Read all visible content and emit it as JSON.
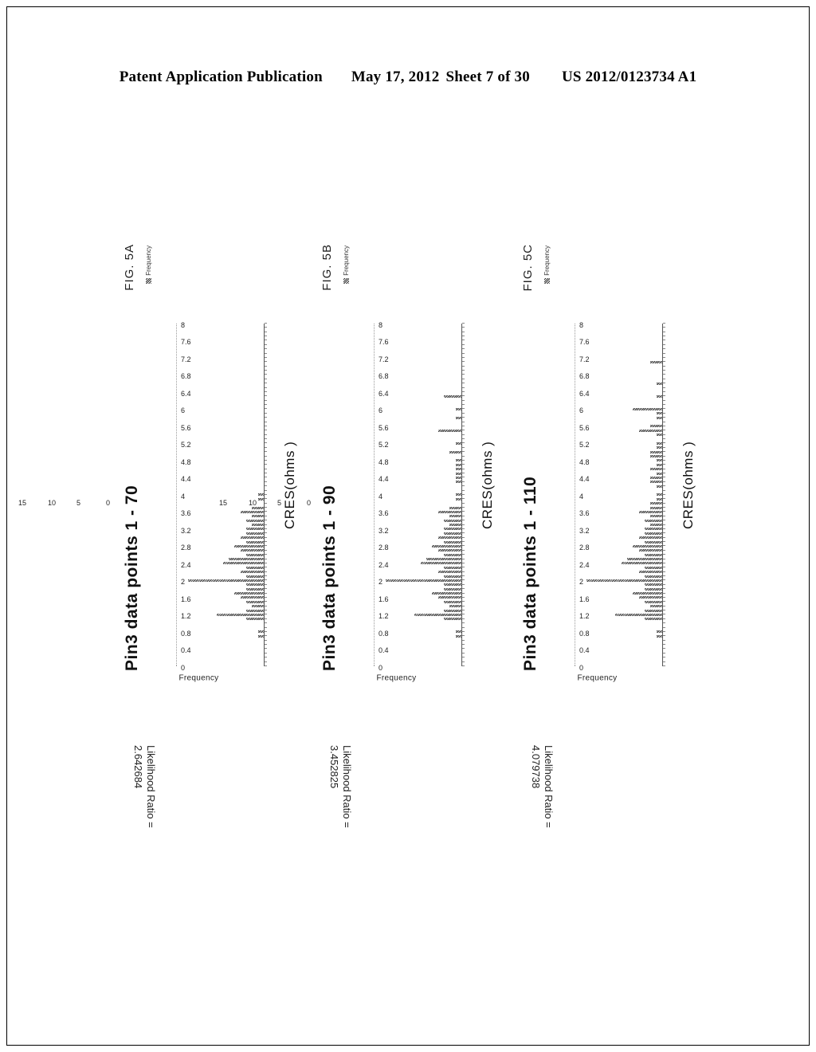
{
  "header": {
    "publication": "Patent Application Publication",
    "date": "May 17, 2012",
    "sheet": "Sheet 7 of 30",
    "docnum": "US 2012/0123734 A1"
  },
  "common": {
    "legend_label": "Frequency",
    "legend_swatch": "hatched-square-icon",
    "xaxis_title": "CRES(ohms )",
    "yaxis_title": "Frequency",
    "y_ticks": [
      "0",
      "5",
      "10",
      "15"
    ],
    "x_ticks": [
      "0",
      "0.4",
      "0.8",
      "1.2",
      "1.6",
      "2",
      "2.4",
      "2.8",
      "3.2",
      "3.6",
      "4",
      "4.4",
      "4.8",
      "5.2",
      "5.6",
      "6",
      "6.4",
      "6.8",
      "7.2",
      "7.6",
      "8"
    ],
    "likelihood_label": "Likelihood Ratio ="
  },
  "figures": [
    {
      "id": "fig-5a",
      "title": "Pin3 data points 1 - 70",
      "label": "FIG. 5A",
      "likelihood_value": "2.642684",
      "chart_data": {
        "type": "bar",
        "title": "Pin3 data points 1 - 70",
        "xlabel": "CRES(ohms )",
        "ylabel": "Frequency",
        "ylim": [
          0,
          15
        ],
        "xlim": [
          0,
          8
        ],
        "grid": true,
        "legend": [
          "Frequency"
        ],
        "legend_position": "top-right",
        "bin_width": 0.1,
        "x": [
          0.7,
          0.8,
          1.1,
          1.2,
          1.3,
          1.4,
          1.5,
          1.6,
          1.7,
          1.8,
          1.9,
          2.0,
          2.1,
          2.2,
          2.3,
          2.4,
          2.5,
          2.6,
          2.7,
          2.8,
          2.9,
          3.0,
          3.1,
          3.2,
          3.3,
          3.4,
          3.5,
          3.6,
          3.7,
          3.9,
          4.0
        ],
        "values": [
          1,
          1,
          3,
          8,
          3,
          2,
          3,
          4,
          5,
          3,
          3,
          13,
          3,
          4,
          3,
          7,
          6,
          3,
          4,
          5,
          3,
          4,
          3,
          3,
          2,
          3,
          2,
          4,
          2,
          1,
          1
        ]
      }
    },
    {
      "id": "fig-5b",
      "title": "Pin3 data points 1 - 90",
      "label": "FIG. 5B",
      "likelihood_value": "3.452825",
      "chart_data": {
        "type": "bar",
        "title": "Pin3 data points 1 - 90",
        "xlabel": "CRES(ohms )",
        "ylabel": "Frequency",
        "ylim": [
          0,
          15
        ],
        "xlim": [
          0,
          8
        ],
        "grid": true,
        "legend": [
          "Frequency"
        ],
        "legend_position": "top-right",
        "bin_width": 0.1,
        "x": [
          0.7,
          0.8,
          1.1,
          1.2,
          1.3,
          1.4,
          1.5,
          1.6,
          1.7,
          1.8,
          1.9,
          2.0,
          2.1,
          2.2,
          2.3,
          2.4,
          2.5,
          2.6,
          2.7,
          2.8,
          2.9,
          3.0,
          3.1,
          3.2,
          3.3,
          3.4,
          3.5,
          3.6,
          3.7,
          3.9,
          4.0,
          4.3,
          4.4,
          4.5,
          4.6,
          4.7,
          4.8,
          5.0,
          5.2,
          5.5,
          5.8,
          6.0,
          6.3
        ],
        "values": [
          1,
          1,
          3,
          8,
          3,
          2,
          3,
          4,
          5,
          3,
          3,
          13,
          3,
          4,
          3,
          7,
          6,
          3,
          4,
          5,
          3,
          4,
          3,
          3,
          2,
          3,
          2,
          4,
          2,
          1,
          1,
          1,
          1,
          1,
          1,
          1,
          1,
          2,
          1,
          4,
          1,
          1,
          3
        ]
      }
    },
    {
      "id": "fig-5c",
      "title": "Pin3 data points 1 - 110",
      "label": "FIG. 5C",
      "likelihood_value": "4.079738",
      "chart_data": {
        "type": "bar",
        "title": "Pin3 data points 1 - 110",
        "xlabel": "CRES(ohms )",
        "ylabel": "Frequency",
        "ylim": [
          0,
          15
        ],
        "xlim": [
          0,
          8
        ],
        "grid": true,
        "legend": [
          "Frequency"
        ],
        "legend_position": "top-right",
        "bin_width": 0.1,
        "x": [
          0.7,
          0.8,
          1.1,
          1.2,
          1.3,
          1.4,
          1.5,
          1.6,
          1.7,
          1.8,
          1.9,
          2.0,
          2.1,
          2.2,
          2.3,
          2.4,
          2.5,
          2.6,
          2.7,
          2.8,
          2.9,
          3.0,
          3.1,
          3.2,
          3.3,
          3.4,
          3.5,
          3.6,
          3.7,
          3.8,
          3.9,
          4.0,
          4.2,
          4.3,
          4.4,
          4.5,
          4.6,
          4.7,
          4.8,
          4.9,
          5.0,
          5.1,
          5.2,
          5.4,
          5.5,
          5.6,
          5.8,
          5.9,
          6.0,
          6.3,
          6.6,
          7.1
        ],
        "values": [
          1,
          1,
          3,
          8,
          3,
          2,
          3,
          4,
          5,
          3,
          3,
          13,
          3,
          4,
          3,
          7,
          6,
          3,
          4,
          5,
          3,
          4,
          3,
          3,
          2,
          3,
          2,
          4,
          2,
          2,
          1,
          1,
          1,
          2,
          2,
          1,
          2,
          1,
          1,
          2,
          2,
          1,
          1,
          1,
          4,
          2,
          1,
          1,
          5,
          1,
          1,
          2
        ]
      }
    }
  ]
}
